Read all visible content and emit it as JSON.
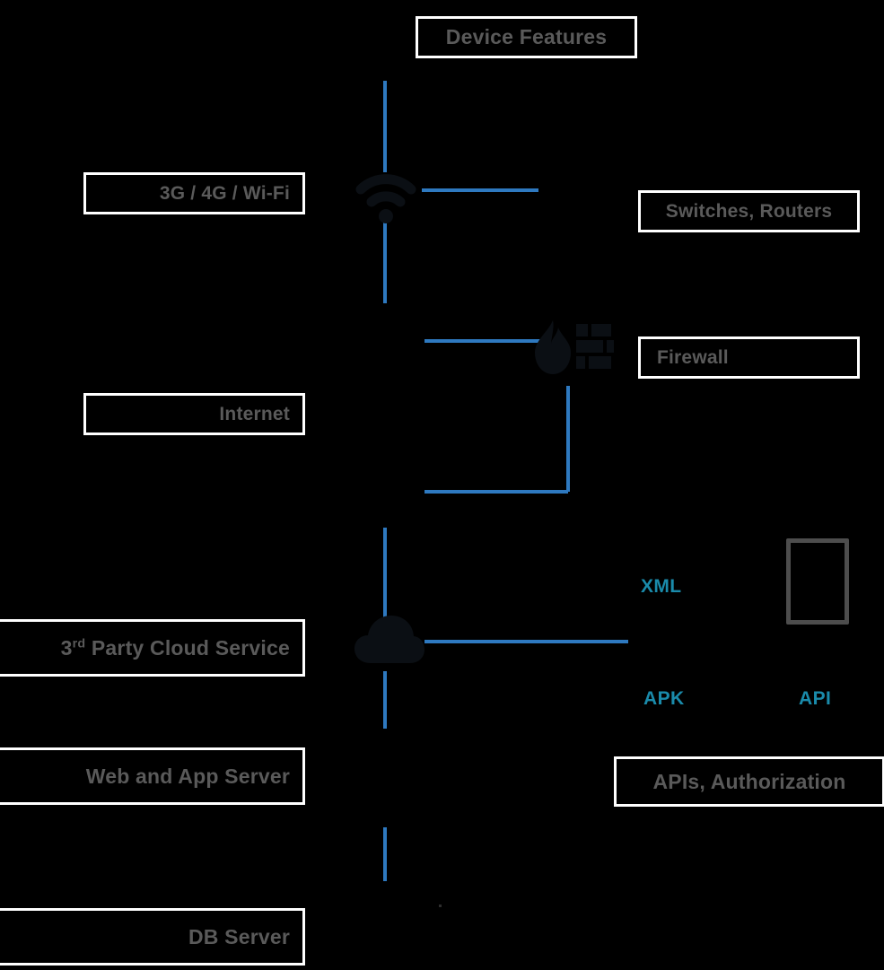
{
  "diagram": {
    "title_box": {
      "label": "Device Features"
    },
    "left_boxes": [
      {
        "id": "network-access",
        "label": "3G / 4G / Wi-Fi"
      },
      {
        "id": "internet",
        "label": "Internet"
      },
      {
        "id": "third-party-cloud",
        "label_prefix": "3",
        "label_sup": "rd",
        "label_rest": " Party Cloud Service"
      },
      {
        "id": "web-app-server",
        "label": "Web and App Server"
      },
      {
        "id": "db-server",
        "label": "DB Server"
      }
    ],
    "right_boxes": [
      {
        "id": "switches-routers",
        "label": "Switches, Routers"
      },
      {
        "id": "firewall",
        "label": "Firewall"
      },
      {
        "id": "apis-authorization",
        "label": "APIs, Authorization"
      }
    ],
    "blue_labels": [
      {
        "id": "xml",
        "label": "XML"
      },
      {
        "id": "apk",
        "label": "APK"
      },
      {
        "id": "api",
        "label": "API"
      }
    ],
    "icons": [
      {
        "id": "wifi",
        "name": "wifi-icon"
      },
      {
        "id": "firewall",
        "name": "firewall-icon"
      },
      {
        "id": "cloud",
        "name": "cloud-icon"
      },
      {
        "id": "device",
        "name": "mobile-device-icon"
      }
    ],
    "colors": {
      "background": "#000000",
      "box_border": "#ffffff",
      "box_text": "#5a5a5a",
      "wire": "#2e79c0",
      "accent_blue": "#1a8bab",
      "device_outline": "#4d4d4d"
    }
  }
}
